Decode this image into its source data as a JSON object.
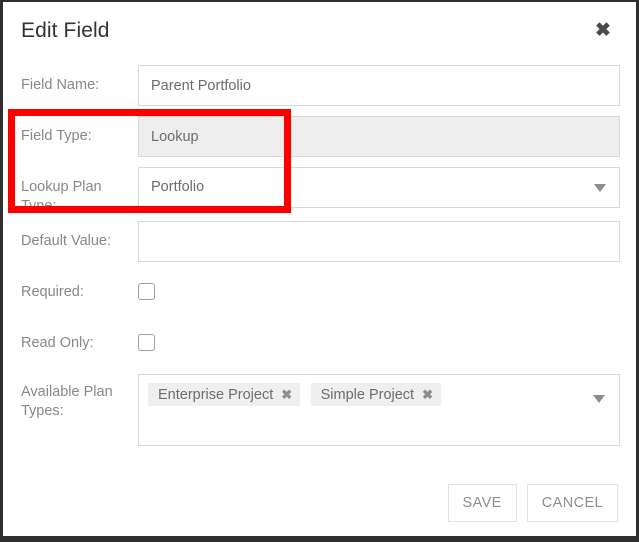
{
  "dialog": {
    "title": "Edit Field",
    "close_icon": "close-icon"
  },
  "fields": {
    "field_name": {
      "label": "Field Name:",
      "value": "Parent Portfolio",
      "placeholder": ""
    },
    "field_type": {
      "label": "Field Type:",
      "value": "Lookup",
      "disabled": true
    },
    "lookup_plan_type": {
      "label": "Lookup Plan Type:",
      "value": "Portfolio",
      "caret_icon": "chevron-down-icon"
    },
    "default_value": {
      "label": "Default Value:",
      "value": "",
      "placeholder": ""
    },
    "required": {
      "label": "Required:",
      "checked": false
    },
    "read_only": {
      "label": "Read Only:",
      "checked": false
    },
    "available_plan_types": {
      "label": "Available Plan Types:",
      "label_line1": "Available Plan",
      "label_line2": "Types:",
      "tags": [
        {
          "label": "Enterprise Project",
          "remove_icon": "✖"
        },
        {
          "label": "Simple Project",
          "remove_icon": "✖"
        }
      ],
      "caret_icon": "chevron-down-icon"
    }
  },
  "footer": {
    "save_label": "SAVE",
    "cancel_label": "CANCEL"
  },
  "annotation": {
    "highlight_color": "#ff0000"
  }
}
